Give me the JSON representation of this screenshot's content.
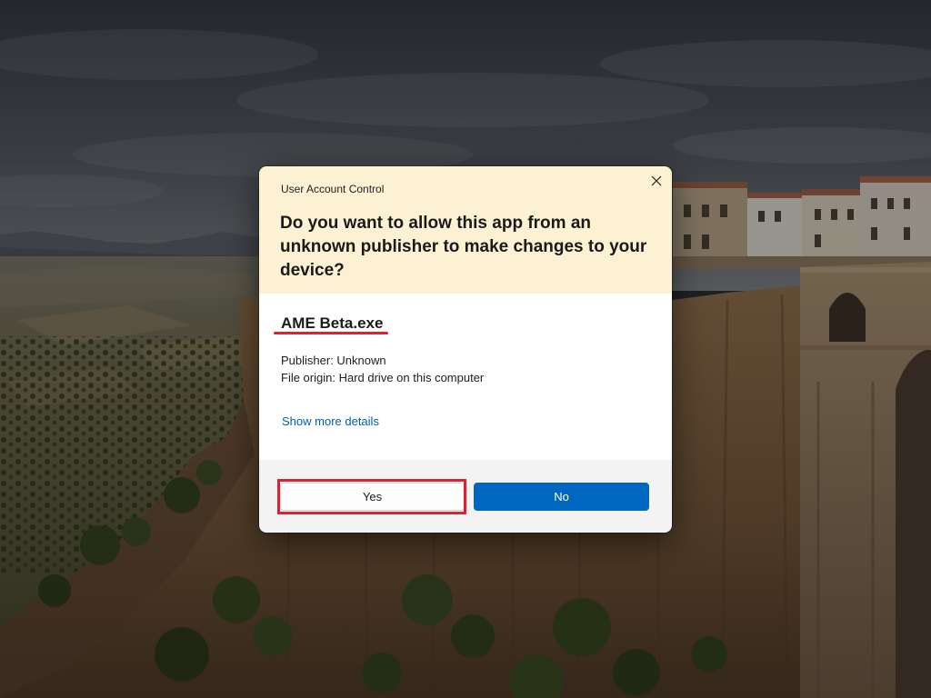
{
  "dialog": {
    "caption": "User Account Control",
    "close_icon": "close-icon",
    "question": "Do you want to allow this app from an unknown publisher to make changes to your device?"
  },
  "app": {
    "name": "AME Beta.exe",
    "publisher": "Publisher: Unknown",
    "file_origin": "File origin: Hard drive on this computer",
    "details_link": "Show more details"
  },
  "buttons": {
    "yes": "Yes",
    "no": "No"
  },
  "colors": {
    "header_background": "#fcf2d3",
    "footer_background": "#f3f3f3",
    "accent": "#0067c0",
    "link": "#005fb8",
    "annotation": "#e4202e"
  }
}
